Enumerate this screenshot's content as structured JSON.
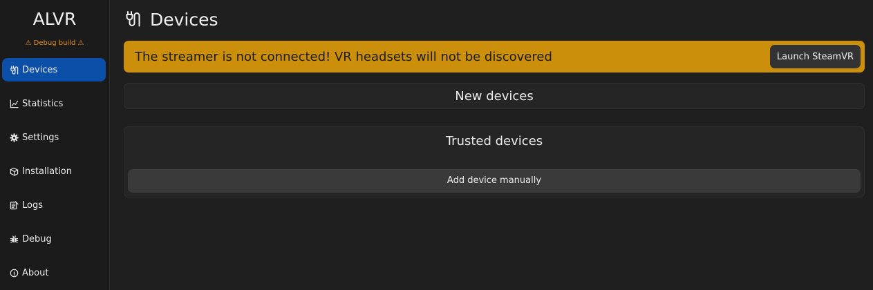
{
  "app": {
    "title": "ALVR",
    "debug_badge": "⚠ Debug build ⚠"
  },
  "sidebar": {
    "items": [
      {
        "label": "Devices",
        "icon": "plug-icon",
        "active": true
      },
      {
        "label": "Statistics",
        "icon": "chart-icon",
        "active": false
      },
      {
        "label": "Settings",
        "icon": "gear-icon",
        "active": false
      },
      {
        "label": "Installation",
        "icon": "installation-icon",
        "active": false
      },
      {
        "label": "Logs",
        "icon": "logs-icon",
        "active": false
      },
      {
        "label": "Debug",
        "icon": "bug-icon",
        "active": false
      },
      {
        "label": "About",
        "icon": "info-icon",
        "active": false
      }
    ]
  },
  "header": {
    "title": "Devices",
    "icon": "plug-icon"
  },
  "banner": {
    "message": "The streamer is not connected! VR headsets will not be discovered",
    "button_label": "Launch SteamVR"
  },
  "new_devices": {
    "title": "New devices"
  },
  "trusted_devices": {
    "title": "Trusted devices",
    "add_button_label": "Add device manually"
  },
  "colors": {
    "accent": "#0c4fa8",
    "warning": "#cc8f0c",
    "debug_text": "#e8901a",
    "background": "#1f1f1f"
  }
}
